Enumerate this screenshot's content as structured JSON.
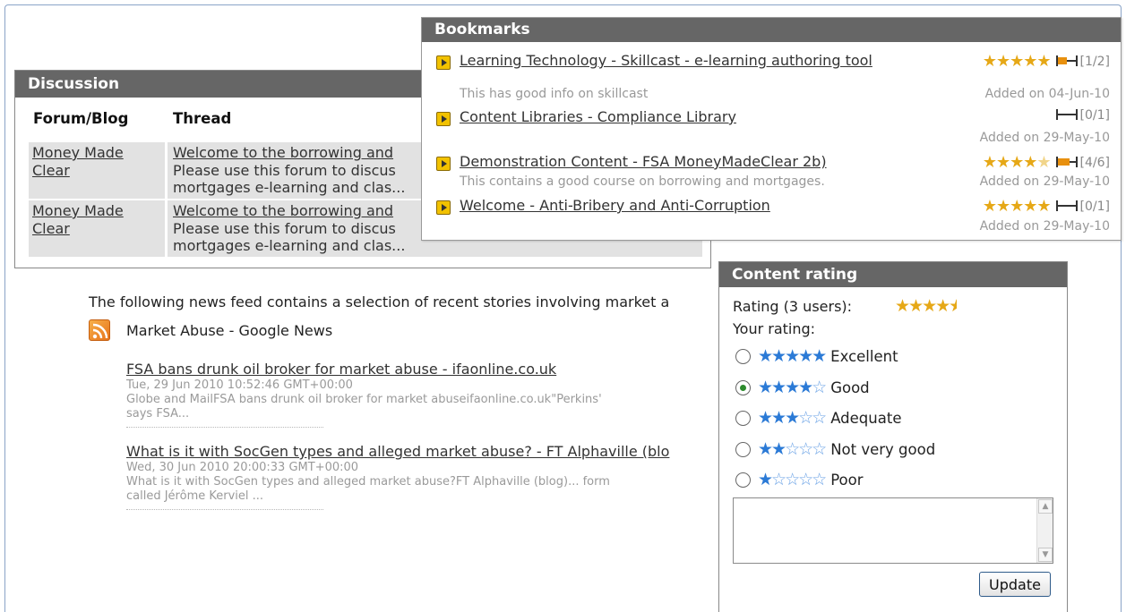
{
  "discussion": {
    "title": "Discussion",
    "col_forum": "Forum/Blog",
    "col_thread": "Thread",
    "rows": [
      {
        "forum_line1": "Money Made",
        "forum_line2": "Clear",
        "thread_title": "Welcome to the borrowing and",
        "thread_line2": "Please use this forum to discus",
        "thread_line3": "mortgages e-learning and clas..."
      },
      {
        "forum_line1": "Money Made",
        "forum_line2": "Clear",
        "thread_title": "Welcome to the borrowing and",
        "thread_line2": "Please use this forum to discus",
        "thread_line3": "mortgages e-learning and clas..."
      }
    ]
  },
  "news": {
    "intro": "The following news feed contains a selection of recent stories involving market a",
    "feed_title": "Market Abuse - Google News",
    "feed_icon": "rss-icon",
    "items": [
      {
        "title": "FSA bans drunk oil broker for market abuse - ifaonline.co.uk",
        "date": "Tue, 29 Jun 2010 10:52:46 GMT+00:00",
        "snippet_line1": "Globe and MailFSA bans drunk oil broker for market abuseifaonline.co.uk\"Perkins'",
        "snippet_line2": "says FSA..."
      },
      {
        "title": "What is it with SocGen types and alleged market abuse? - FT Alphaville (blo",
        "date": "Wed, 30 Jun 2010 20:00:33 GMT+00:00",
        "snippet_line1": "What is it with SocGen types and alleged market abuse?FT Alphaville (blog)... form",
        "snippet_line2": "called Jérôme Kerviel ..."
      }
    ]
  },
  "bookmarks": {
    "title": "Bookmarks",
    "items": [
      {
        "title": "Learning Technology - Skillcast - e-learning authoring tool",
        "note": "This has good info on skillcast",
        "stars": 5,
        "progress": 0.5,
        "count": "[1/2]",
        "added": "Added on 04-Jun-10"
      },
      {
        "title": "Content Libraries - Compliance Library",
        "note": "",
        "stars": 0,
        "progress": 0,
        "count": "[0/1]",
        "added": "Added on 29-May-10"
      },
      {
        "title": "Demonstration Content - FSA MoneyMadeClear 2b)",
        "note": "This contains a good course on borrowing and mortgages.",
        "stars": 4,
        "progress": 0.67,
        "count": "[4/6]",
        "added": "Added on 29-May-10"
      },
      {
        "title": "Welcome - Anti-Bribery and Anti-Corruption",
        "note": "",
        "stars": 5,
        "progress": 0,
        "count": "[0/1]",
        "added": "Added on 29-May-10"
      }
    ]
  },
  "rating": {
    "title": "Content rating",
    "summary_label": "Rating (3 users):",
    "average_stars": 4.5,
    "your_rating_label": "Your rating:",
    "options": [
      {
        "stars": 5,
        "label": "Excellent",
        "selected": false
      },
      {
        "stars": 4,
        "label": "Good",
        "selected": true
      },
      {
        "stars": 3,
        "label": "Adequate",
        "selected": false
      },
      {
        "stars": 2,
        "label": "Not very good",
        "selected": false
      },
      {
        "stars": 1,
        "label": "Poor",
        "selected": false
      }
    ],
    "comment_value": "",
    "update_label": "Update"
  },
  "colors": {
    "panel_header": "#666666",
    "gold_star": "#e6a817",
    "blue_star": "#2b7ad6",
    "progress_fill": "#e8900e"
  }
}
